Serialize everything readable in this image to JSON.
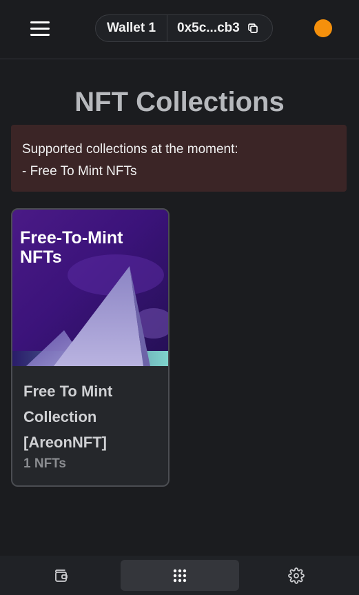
{
  "header": {
    "wallet_name": "Wallet 1",
    "wallet_address": "0x5c...cb3",
    "status_color": "#f5900c"
  },
  "page": {
    "title": "NFT Collections"
  },
  "notice": {
    "line1": "Supported collections at the moment:",
    "line2": "- Free To Mint NFTs"
  },
  "collections": [
    {
      "image_text_line1": "Free-To-Mint",
      "image_text_line2": "NFTs",
      "title": "Free To Mint Collection [AreonNFT]",
      "count": "1 NFTs"
    }
  ],
  "bottom_nav": {
    "items": [
      {
        "icon": "wallet-icon",
        "active": false
      },
      {
        "icon": "apps-grid-icon",
        "active": true
      },
      {
        "icon": "settings-gear-icon",
        "active": false
      }
    ]
  },
  "colors": {
    "background": "#1b1c1f",
    "notice_bg": "#3b2526",
    "accent_orange": "#f5900c"
  }
}
